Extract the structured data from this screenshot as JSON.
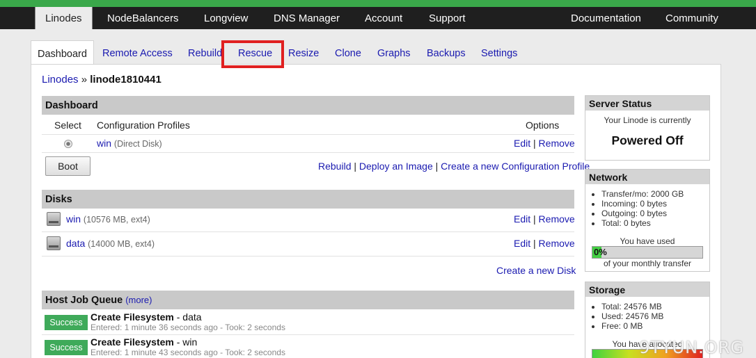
{
  "top_nav": {
    "items": [
      "Linodes",
      "NodeBalancers",
      "Longview",
      "DNS Manager",
      "Account",
      "Support"
    ],
    "right_items": [
      "Documentation",
      "Community"
    ]
  },
  "sub_tabs": [
    "Dashboard",
    "Remote Access",
    "Rebuild",
    "Rescue",
    "Resize",
    "Clone",
    "Graphs",
    "Backups",
    "Settings"
  ],
  "breadcrumb": {
    "parent": "Linodes",
    "sep": "»",
    "current": "linode1810441"
  },
  "dashboard": {
    "heading": "Dashboard",
    "columns": {
      "select": "Select",
      "profiles": "Configuration Profiles",
      "options": "Options"
    },
    "profile": {
      "name": "win",
      "detail": "(Direct Disk)",
      "edit": "Edit",
      "sep": "|",
      "remove": "Remove"
    },
    "boot_label": "Boot",
    "actions": {
      "rebuild": "Rebuild",
      "deploy": "Deploy an Image",
      "create_profile": "Create a new Configuration Profile",
      "sep": "|"
    }
  },
  "disks": {
    "heading": "Disks",
    "items": [
      {
        "name": "win",
        "detail": "(10576 MB, ext4)",
        "edit": "Edit",
        "sep": "|",
        "remove": "Remove"
      },
      {
        "name": "data",
        "detail": "(14000 MB, ext4)",
        "edit": "Edit",
        "sep": "|",
        "remove": "Remove"
      }
    ],
    "create_link": "Create a new Disk"
  },
  "host_job_queue": {
    "heading": "Host Job Queue",
    "more": "(more)",
    "jobs": [
      {
        "status": "Success",
        "title": "Create Filesystem",
        "target": " - data",
        "entered": "Entered: 1 minute 36 seconds ago - Took: 2 seconds"
      },
      {
        "status": "Success",
        "title": "Create Filesystem",
        "target": " - win",
        "entered": "Entered: 1 minute 43 seconds ago - Took: 2 seconds"
      }
    ]
  },
  "server_status": {
    "heading": "Server Status",
    "line": "Your Linode is currently",
    "state": "Powered Off"
  },
  "network": {
    "heading": "Network",
    "items": [
      "Transfer/mo: 2000 GB",
      "Incoming: 0 bytes",
      "Outgoing: 0 bytes",
      "Total: 0 bytes"
    ],
    "used_label": "You have used",
    "percent_label": "0%",
    "percent": 0,
    "transfer_label": "of your monthly transfer"
  },
  "storage": {
    "heading": "Storage",
    "items": [
      "Total: 24576 MB",
      "Used: 24576 MB",
      "Free: 0 MB"
    ],
    "allocated_label": "You have allocated",
    "percent": 100
  },
  "watermark": "9TYUN.ORG",
  "colors": {
    "accent_green": "#3aa84a",
    "link": "#1a1ab0",
    "highlight": "#e02020",
    "success": "#3faa5a"
  }
}
